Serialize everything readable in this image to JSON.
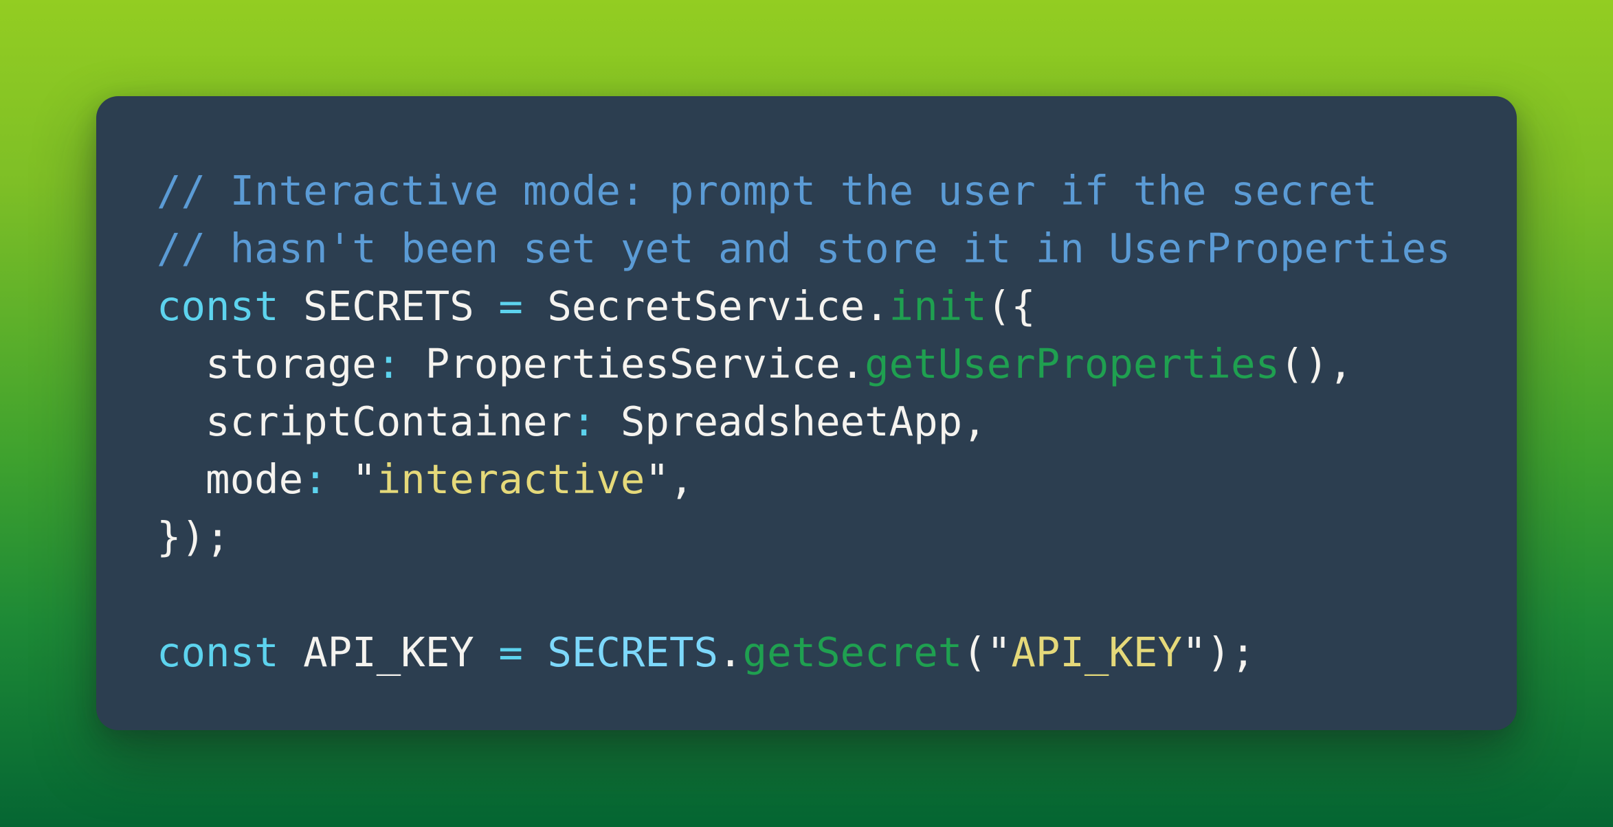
{
  "background": {
    "gradient_top": "#93cd22",
    "gradient_bottom": "#056633"
  },
  "card": {
    "background": "#2c3e50"
  },
  "syntax_colors": {
    "comment": "#5b9bd5",
    "keyword": "#5dd3ee",
    "operator": "#5dd3ee",
    "plain": "#f5f3ef",
    "method": "#1fa050",
    "string": "#e5d97a",
    "reference": "#7dd8fb"
  },
  "code": {
    "language": "javascript",
    "lines": [
      {
        "tokens": [
          {
            "type": "comment",
            "text": "// Interactive mode: prompt the user if the secret"
          }
        ]
      },
      {
        "tokens": [
          {
            "type": "comment",
            "text": "// hasn't been set yet and store it in UserProperties"
          }
        ]
      },
      {
        "tokens": [
          {
            "type": "keyword",
            "text": "const"
          },
          {
            "type": "plain",
            "text": " SECRETS "
          },
          {
            "type": "op",
            "text": "="
          },
          {
            "type": "plain",
            "text": " SecretService."
          },
          {
            "type": "method",
            "text": "init"
          },
          {
            "type": "plain",
            "text": "({"
          }
        ]
      },
      {
        "tokens": [
          {
            "type": "plain",
            "text": "  storage"
          },
          {
            "type": "op",
            "text": ":"
          },
          {
            "type": "plain",
            "text": " PropertiesService."
          },
          {
            "type": "method",
            "text": "getUserProperties"
          },
          {
            "type": "plain",
            "text": "(),"
          }
        ]
      },
      {
        "tokens": [
          {
            "type": "plain",
            "text": "  scriptContainer"
          },
          {
            "type": "op",
            "text": ":"
          },
          {
            "type": "plain",
            "text": " SpreadsheetApp,"
          }
        ]
      },
      {
        "tokens": [
          {
            "type": "plain",
            "text": "  mode"
          },
          {
            "type": "op",
            "text": ":"
          },
          {
            "type": "plain",
            "text": " \""
          },
          {
            "type": "string",
            "text": "interactive"
          },
          {
            "type": "plain",
            "text": "\","
          }
        ]
      },
      {
        "tokens": [
          {
            "type": "plain",
            "text": "});"
          }
        ]
      },
      {
        "tokens": []
      },
      {
        "tokens": [
          {
            "type": "keyword",
            "text": "const"
          },
          {
            "type": "plain",
            "text": " API_KEY "
          },
          {
            "type": "op",
            "text": "="
          },
          {
            "type": "plain",
            "text": " "
          },
          {
            "type": "ref",
            "text": "SECRETS"
          },
          {
            "type": "plain",
            "text": "."
          },
          {
            "type": "method",
            "text": "getSecret"
          },
          {
            "type": "plain",
            "text": "(\""
          },
          {
            "type": "string",
            "text": "API_KEY"
          },
          {
            "type": "plain",
            "text": "\");"
          }
        ]
      }
    ]
  }
}
